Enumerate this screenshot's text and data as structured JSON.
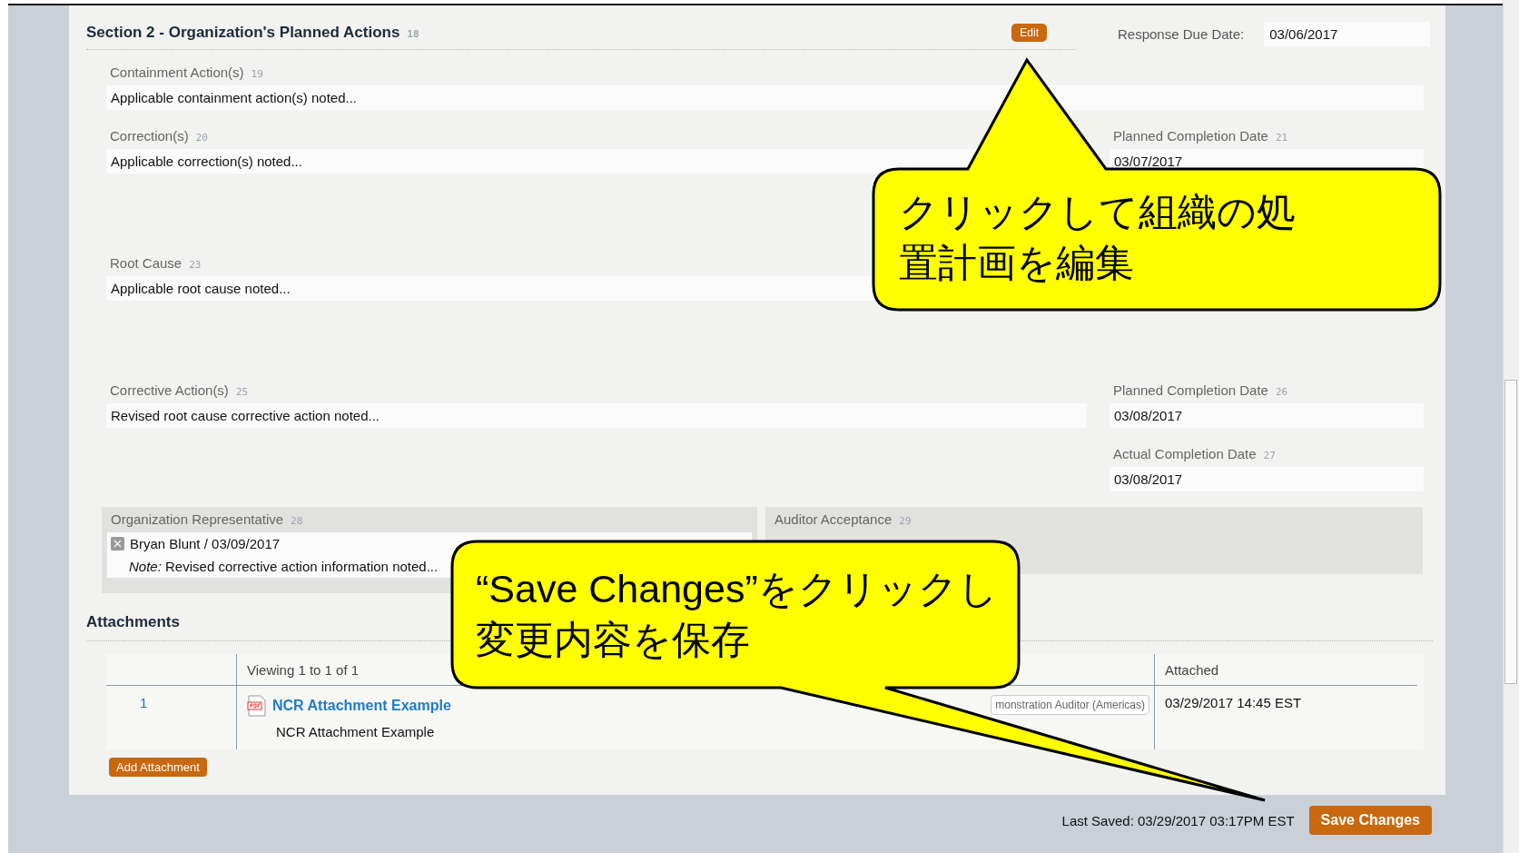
{
  "section": {
    "title": "Section 2 - Organization's Planned Actions",
    "number": "18",
    "edit_button": "Edit",
    "response_due": {
      "label": "Response Due Date:",
      "value": "03/06/2017"
    }
  },
  "rows": [
    {
      "main": {
        "label": "Containment Action(s)",
        "number": "19",
        "value": "Applicable containment action(s) noted..."
      }
    },
    {
      "main": {
        "label": "Correction(s)",
        "number": "20",
        "value": "Applicable correction(s) noted..."
      },
      "side": {
        "label": "Planned Completion Date",
        "number": "21",
        "value": "03/07/2017"
      }
    },
    {
      "main": {
        "label": "Root Cause",
        "number": "23",
        "value": "Applicable root cause noted..."
      }
    },
    {
      "main": {
        "label": "Corrective Action(s)",
        "number": "25",
        "value": "Revised root cause corrective action noted..."
      },
      "side": {
        "label": "Planned Completion Date",
        "number": "26",
        "value": "03/08/2017"
      }
    },
    {
      "side": {
        "label": "Actual Completion Date",
        "number": "27",
        "value": "03/08/2017"
      }
    }
  ],
  "organization_representative": {
    "label": "Organization Representative",
    "number": "28",
    "signature": "Bryan Blunt / 03/09/2017",
    "note": "*Note:* Revised corrective action information noted..."
  },
  "auditor_acceptance": {
    "label": "Auditor Acceptance",
    "number": "29"
  },
  "attachments": {
    "title": "Attachments",
    "columns": [
      "Viewing 1 to 1 of 1",
      "Attached"
    ],
    "rows": [
      {
        "index": "1",
        "name": "NCR Attachment Example",
        "description": "NCR Attachment Example",
        "author": "monstration Auditor (Americas)",
        "attached": "03/29/2017 14:45 EST"
      }
    ],
    "add_button": "Add Attachment"
  },
  "footer": {
    "last_saved": "Last Saved: 03/29/2017 03:17PM EST",
    "save_button": "Save Changes"
  },
  "callouts": [
    {
      "lines": [
        "クリックして組織の処",
        "置計画を編集"
      ]
    },
    {
      "lines": [
        "“Save Changes”をクリックし",
        "変更内容を保存"
      ]
    }
  ]
}
